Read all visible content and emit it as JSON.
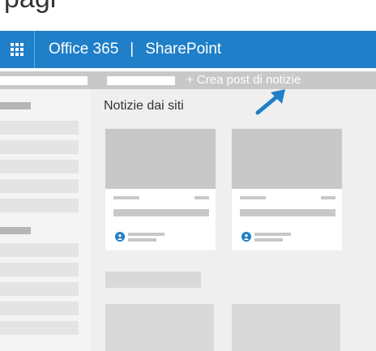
{
  "header_text": "pagi",
  "suite_bar": {
    "app_name": "Office 365",
    "separator": "|",
    "product_name": "SharePoint",
    "background_color": "#1f7fc8",
    "waffle_icon": "waffle-icon"
  },
  "command_bar": {
    "new_post_label": "+ Crea post di notizie"
  },
  "main": {
    "section_title": "Notizie dai siti"
  },
  "annotation": {
    "arrow_icon": "arrow-icon",
    "color": "#1f7fc8"
  },
  "icons": [
    "waffle-icon",
    "arrow-icon",
    "person-icon"
  ]
}
